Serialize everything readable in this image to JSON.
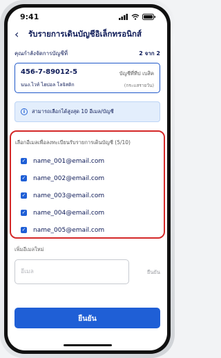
{
  "status_bar": {
    "time": "9:41"
  },
  "header": {
    "back_icon": "chevron-left-icon",
    "title": "รับรายการเดินบัญชีอิเล็กทรอนิกส์"
  },
  "step": {
    "label": "คุณกำลังจัดการบัญชีที่",
    "value": "2 จาก 2"
  },
  "account": {
    "number": "456-7-89012-5",
    "name": "นนง.ไวท์ ไฮปอล โลจิสติก",
    "type": "บัญชีที่ทีป เบสิค",
    "subtype": "(กระแสรายวัน)"
  },
  "info": {
    "icon": "info-icon",
    "text": "สามารถเลือกได้สูงสุด 10 อีเมล/บัญชี"
  },
  "select_panel": {
    "title": "เลือกอีเมลเพื่อลงทะเบียนรับรายการเดินบัญชี (5/10)",
    "emails": [
      {
        "label": "name_001@email.com",
        "checked": true
      },
      {
        "label": "name_002@email.com",
        "checked": true
      },
      {
        "label": "name_003@email.com",
        "checked": true
      },
      {
        "label": "name_004@email.com",
        "checked": true
      },
      {
        "label": "name_005@email.com",
        "checked": true
      }
    ]
  },
  "add_email": {
    "label": "เพิ่มอีเมลใหม่",
    "placeholder": "อีเมล",
    "value": "",
    "button": "ยืนยัน"
  },
  "footer": {
    "confirm_label": "ยืนยัน"
  },
  "colors": {
    "primary": "#1f5fd6",
    "navy": "#0d1a57",
    "highlight": "#d42828",
    "info_bg": "#e3eefc"
  }
}
